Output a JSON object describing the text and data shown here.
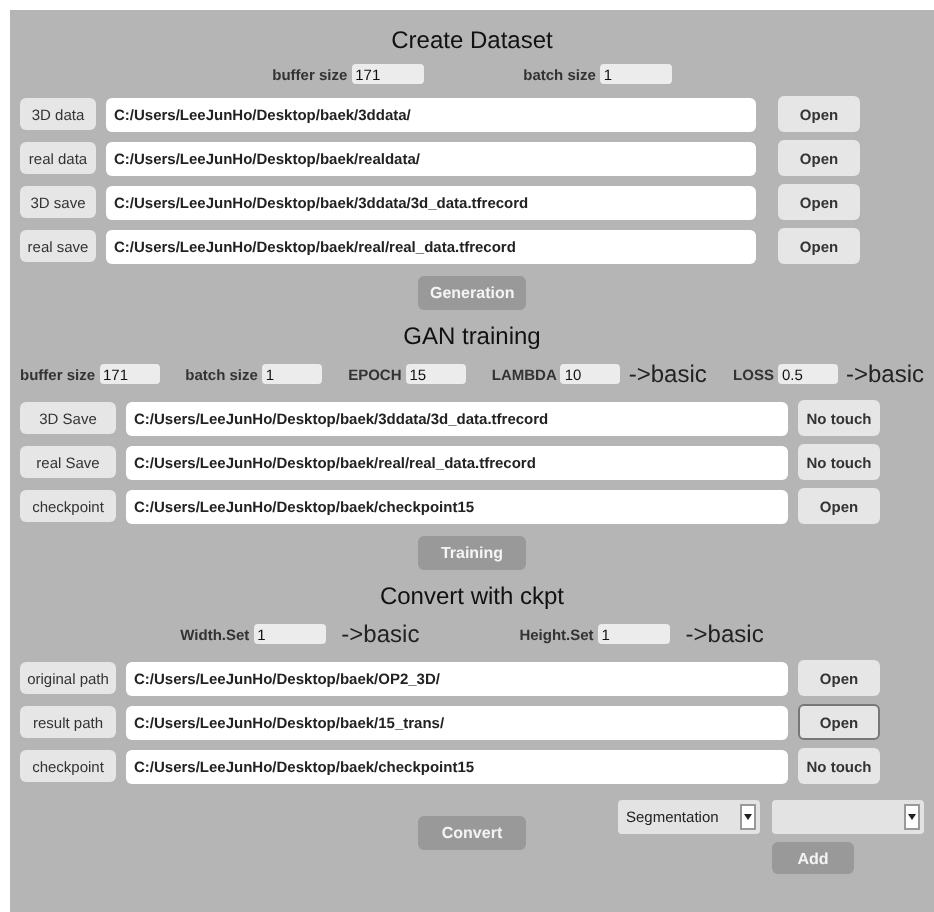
{
  "sections": [
    {
      "title": "Create Dataset",
      "params": [
        {
          "label": "buffer size",
          "value": "171"
        },
        {
          "label": "batch size",
          "value": "1"
        }
      ],
      "rows": [
        {
          "label": "3D data",
          "path": "C:/Users/LeeJunHo/Desktop/baek/3ddata/",
          "button": {
            "label": "Open",
            "focused": false
          }
        },
        {
          "label": "real data",
          "path": "C:/Users/LeeJunHo/Desktop/baek/realdata/",
          "button": {
            "label": "Open",
            "focused": false
          }
        },
        {
          "label": "3D save",
          "path": "C:/Users/LeeJunHo/Desktop/baek/3ddata/3d_data.tfrecord",
          "button": {
            "label": "Open",
            "focused": false
          }
        },
        {
          "label": "real save",
          "path": "C:/Users/LeeJunHo/Desktop/baek/real/real_data.tfrecord",
          "button": {
            "label": "Open",
            "focused": false
          }
        }
      ],
      "action": "Generation"
    },
    {
      "title": "GAN training",
      "params": [
        {
          "label": "buffer size",
          "value": "171"
        },
        {
          "label": "batch size",
          "value": "1"
        },
        {
          "label": "EPOCH",
          "value": "15"
        },
        {
          "label": "LAMBDA",
          "value": "10",
          "note": "->basic"
        },
        {
          "label": "LOSS",
          "value": "0.5",
          "note": "->basic"
        }
      ],
      "rows": [
        {
          "label": "3D Save",
          "path": "C:/Users/LeeJunHo/Desktop/baek/3ddata/3d_data.tfrecord",
          "button": {
            "label": "No touch",
            "focused": false
          }
        },
        {
          "label": "real Save",
          "path": "C:/Users/LeeJunHo/Desktop/baek/real/real_data.tfrecord",
          "button": {
            "label": "No touch",
            "focused": false
          }
        },
        {
          "label": "checkpoint",
          "path": "C:/Users/LeeJunHo/Desktop/baek/checkpoint15",
          "button": {
            "label": "Open",
            "focused": false
          }
        }
      ],
      "action": "Training"
    },
    {
      "title": "Convert with ckpt",
      "params": [
        {
          "label": "Width.Set",
          "value": "1",
          "note": "->basic"
        },
        {
          "label": "Height.Set",
          "value": "1",
          "note": "->basic"
        }
      ],
      "rows": [
        {
          "label": "original path",
          "path": "C:/Users/LeeJunHo/Desktop/baek/OP2_3D/",
          "button": {
            "label": "Open",
            "focused": false
          }
        },
        {
          "label": "result path",
          "path": "C:/Users/LeeJunHo/Desktop/baek/15_trans/",
          "button": {
            "label": "Open",
            "focused": true
          }
        },
        {
          "label": "checkpoint",
          "path": "C:/Users/LeeJunHo/Desktop/baek/checkpoint15",
          "button": {
            "label": "No touch",
            "focused": false
          }
        }
      ],
      "action": "Convert",
      "selects": [
        {
          "kind": "select",
          "value": "Segmentation"
        },
        {
          "kind": "select"
        }
      ],
      "add": "Add"
    }
  ]
}
